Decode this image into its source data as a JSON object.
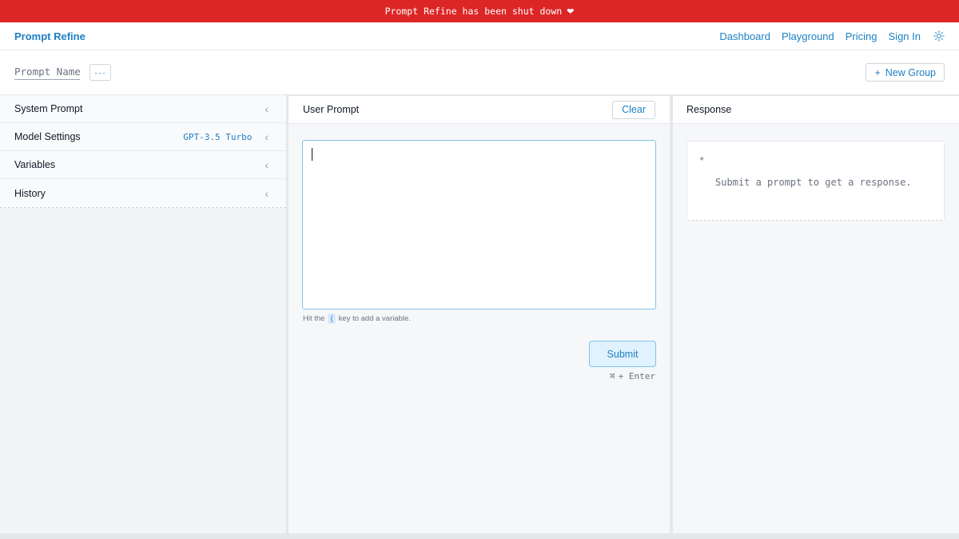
{
  "banner": {
    "text": "Prompt Refine has been shut down"
  },
  "nav": {
    "brand": "Prompt Refine",
    "links": [
      "Dashboard",
      "Playground",
      "Pricing",
      "Sign In"
    ]
  },
  "subbar": {
    "prompt_name_placeholder": "Prompt Name",
    "more_label": "···",
    "new_group_label": "New Group"
  },
  "sidebar": {
    "items": [
      {
        "label": "System Prompt",
        "value": ""
      },
      {
        "label": "Model Settings",
        "value": "GPT-3.5 Turbo"
      },
      {
        "label": "Variables",
        "value": ""
      },
      {
        "label": "History",
        "value": ""
      }
    ]
  },
  "user_prompt": {
    "title": "User Prompt",
    "clear_label": "Clear",
    "value": "",
    "hint_before": "Hit the",
    "hint_key": "{",
    "hint_after": "key to add a variable.",
    "submit_label": "Submit",
    "shortcut": "+ Enter"
  },
  "response": {
    "title": "Response",
    "placeholder": "Submit a prompt to get a response."
  },
  "colors": {
    "banner": "#dc2626",
    "accent": "#1d7fc2",
    "focus_border": "#7fc3e6"
  }
}
